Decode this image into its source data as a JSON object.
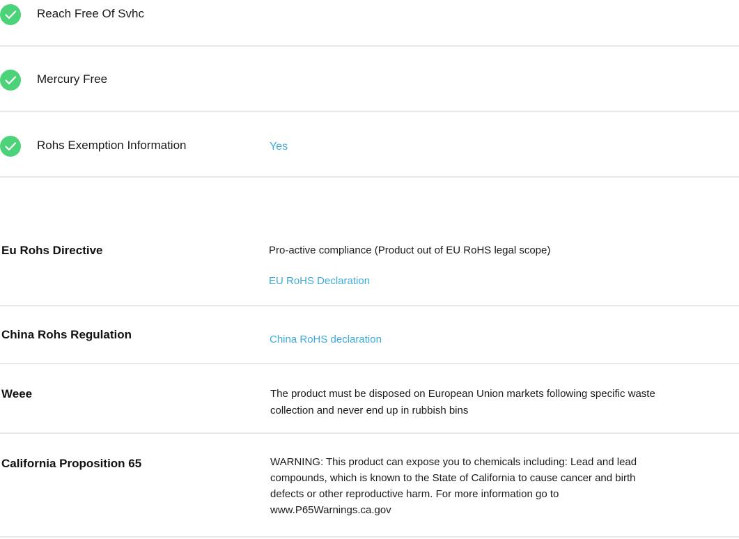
{
  "colors": {
    "check_green": "#4cd37a",
    "link_blue": "#3fa9dc",
    "divider": "#e8e8e8"
  },
  "features": [
    {
      "label": "Reach Free Of Svhc",
      "icon": "check-circle-icon"
    },
    {
      "label": "Mercury Free",
      "icon": "check-circle-icon"
    },
    {
      "label": "Rohs Exemption Information",
      "value": "Yes",
      "icon": "check-circle-icon"
    }
  ],
  "specs": {
    "eu_rohs": {
      "title": "Eu Rohs Directive",
      "text": "Pro-active compliance (Product out of EU RoHS legal scope)",
      "link": "EU RoHS Declaration"
    },
    "china_rohs": {
      "title": "China Rohs Regulation",
      "link": "China RoHS declaration"
    },
    "weee": {
      "title": "Weee",
      "text_line1": "The product must be disposed on European Union markets following specific waste",
      "text_line2": "collection and never end up in rubbish bins"
    },
    "prop65": {
      "title": "California Proposition 65",
      "text_line1": "WARNING: This product can expose you to chemicals including: Lead and lead",
      "text_line2": "compounds, which is known to the State of California to cause cancer and birth",
      "text_line3": "defects or other reproductive harm. For more information go to",
      "text_line4": "www.P65Warnings.ca.gov"
    }
  }
}
